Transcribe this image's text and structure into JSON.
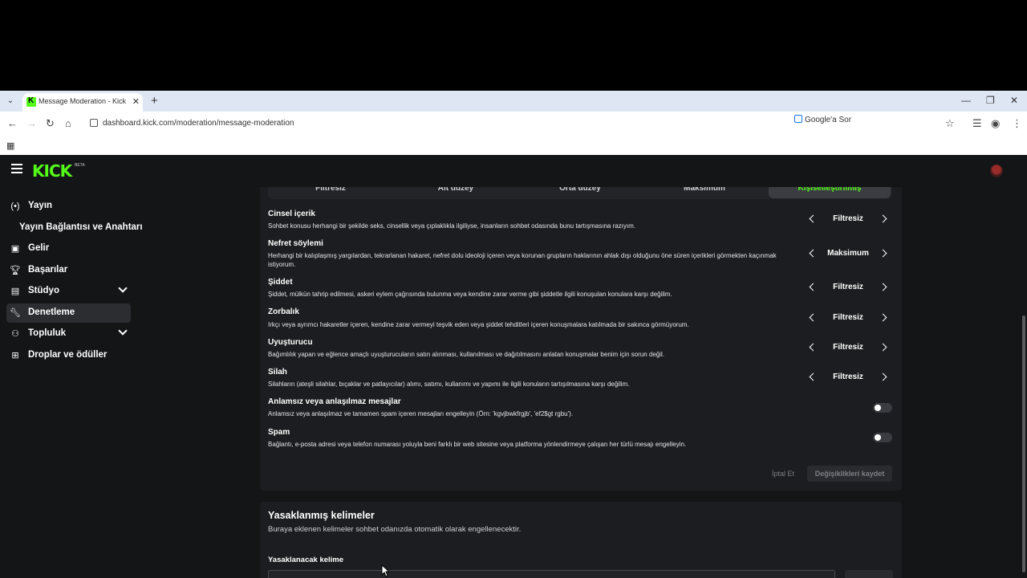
{
  "browser": {
    "tab_title": "Message Moderation - Kick Da",
    "url": "dashboard.kick.com/moderation/message-moderation",
    "ask_google_label": "Google'a Sor"
  },
  "app": {
    "logo_text": "KICK",
    "logo_badge": "BETA"
  },
  "sidebar": {
    "items": [
      {
        "label": "Yayın",
        "icon": "broadcast-icon"
      },
      {
        "label": "Yayın Bağlantısı ve Anahtarı",
        "icon": ""
      },
      {
        "label": "Gelir",
        "icon": "revenue-icon"
      },
      {
        "label": "Başarılar",
        "icon": "trophy-icon"
      },
      {
        "label": "Stüdyo",
        "icon": "studio-icon"
      },
      {
        "label": "Denetleme",
        "icon": "wrench-icon"
      },
      {
        "label": "Topluluk",
        "icon": "community-icon"
      },
      {
        "label": "Droplar ve ödüller",
        "icon": "drops-icon"
      }
    ],
    "active": "Denetleme"
  },
  "moderation": {
    "levels": [
      "Filtresiz",
      "Alt düzey",
      "Orta düzey",
      "Maksimum",
      "Kişiselleştirilmiş"
    ],
    "selected_level": "Kişiselleştirilmiş",
    "categories": [
      {
        "title": "Cinsel içerik",
        "desc": "Sohbet konusu herhangi bir şekilde seks, cinsellik veya çıplaklıkla ilgiliyse, insanların sohbet odasında bunu tartışmasına razıyım.",
        "value": "Filtresiz"
      },
      {
        "title": "Nefret söylemi",
        "desc": "Herhangi bir kalıplaşmış yargılardan, tekrarlanan hakaret, nefret dolu ideoloji içeren veya korunan grupların haklarının ahlak dışı olduğunu öne süren içerikleri görmekten kaçınmak istiyorum.",
        "value": "Maksimum"
      },
      {
        "title": "Şiddet",
        "desc": "Şiddet, mülkün tahrip edilmesi, askeri eylem çağrısında bulunma veya kendine zarar verme gibi şiddetle ilgili konuşulan konulara karşı değilim.",
        "value": "Filtresiz"
      },
      {
        "title": "Zorbalık",
        "desc": "Irkçı veya ayrımcı hakaretler içeren, kendine zarar vermeyi teşvik eden veya şiddet tehditleri içeren konuşmalara katılmada bir sakınca görmüyorum.",
        "value": "Filtresiz"
      },
      {
        "title": "Uyuşturucu",
        "desc": "Bağımlılık yapan ve eğlence amaçlı uyuşturucuların satın alınması, kullanılması ve dağıtılmasını anlatan konuşmalar benim için sorun değil.",
        "value": "Filtresiz"
      },
      {
        "title": "Silah",
        "desc": "Silahların (ateşli silahlar, bıçaklar ve patlayıcılar) alımı, satımı, kullanımı ve yapımı ile ilgili konuların tartışılmasına karşı değilim.",
        "value": "Filtresiz"
      }
    ],
    "toggles": [
      {
        "title": "Anlamsız veya anlaşılmaz mesajlar",
        "desc": "Anlamsız veya anlaşılmaz ve tamamen spam içeren mesajları engelleyin (Örn: 'kgvjbwkfrgjb', 'ef2$gt rgbu').",
        "on": false
      },
      {
        "title": "Spam",
        "desc": "Bağlantı, e-posta adresi veya telefon numarası yoluyla beni farklı bir web sitesine veya platforma yönlendirmeye çalışan her türlü mesajı engelleyin.",
        "on": false
      }
    ],
    "cancel_label": "İptal Et",
    "save_label": "Değişiklikleri kaydet"
  },
  "banned_words": {
    "title": "Yasaklanmış kelimeler",
    "desc": "Buraya eklenen kelimeler sohbet odanızda otomatik olarak engellenecektir.",
    "input_label": "Yasaklanacak kelime"
  },
  "colors": {
    "accent": "#53fc18",
    "background": "#141517",
    "panel": "#1c1d20"
  }
}
